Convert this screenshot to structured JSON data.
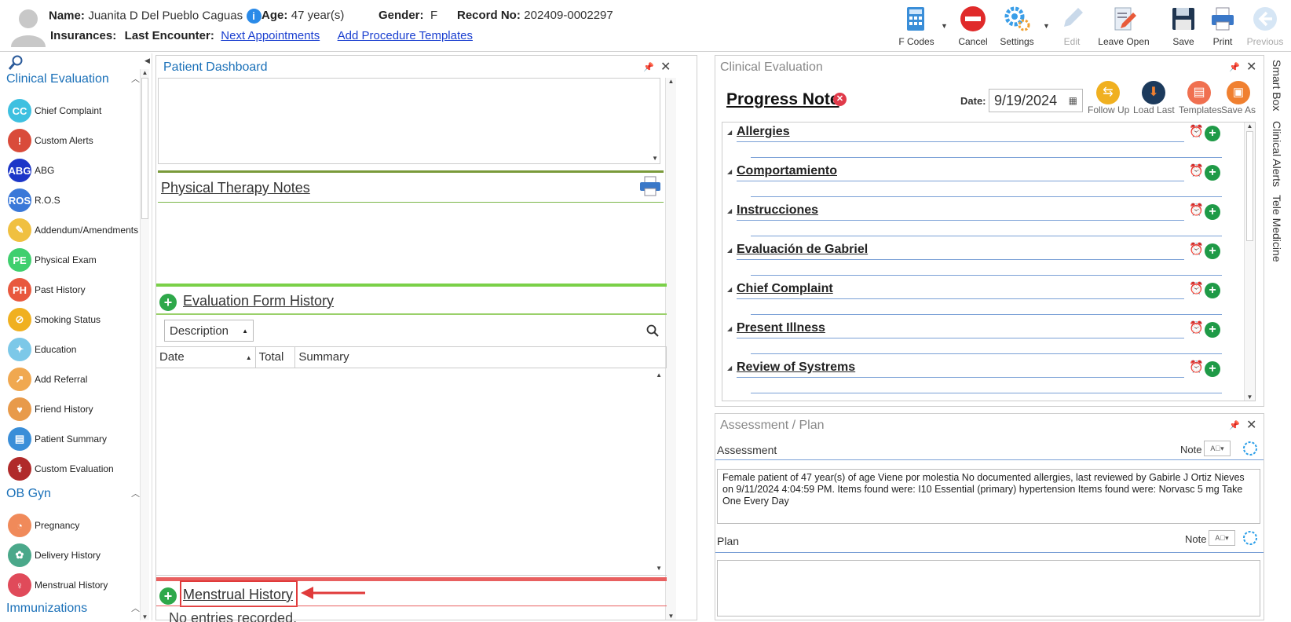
{
  "header": {
    "name_label": "Name:",
    "name_value": "Juanita D Del Pueblo Caguas",
    "age_label": "Age:",
    "age_value": "47 year(s)",
    "gender_label": "Gender:",
    "gender_value": "F",
    "record_label": "Record No:",
    "record_value": "202409-0002297",
    "insurances_label": "Insurances:",
    "last_encounter_label": "Last Encounter:",
    "next_appointments_link": "Next Appointments",
    "add_procedure_link": "Add Procedure Templates",
    "info_glyph": "i"
  },
  "toolbar": {
    "fcodes": "F Codes",
    "cancel": "Cancel",
    "settings": "Settings",
    "edit": "Edit",
    "leave_open": "Leave Open",
    "save": "Save",
    "print": "Print",
    "previous": "Previous"
  },
  "sidebar": {
    "clinical_header": "Clinical Evaluation",
    "obgyn_header": "OB Gyn",
    "immunizations_header": "Immunizations",
    "items": [
      {
        "label": "Chief Complaint",
        "glyph": "CC",
        "color": "#3ec0e0",
        "icon": "chief-complaint-icon"
      },
      {
        "label": "Custom Alerts",
        "glyph": "!",
        "color": "#d94b3a",
        "icon": "alert-bell-icon"
      },
      {
        "label": "ABG",
        "glyph": "ABG",
        "color": "#1c36c8",
        "icon": "abg-icon"
      },
      {
        "label": "R.O.S",
        "glyph": "ROS",
        "color": "#3a78d8",
        "icon": "ros-icon"
      },
      {
        "label": "Addendum/Amendments",
        "glyph": "✎",
        "color": "#f0c040",
        "icon": "addendum-icon"
      },
      {
        "label": "Physical Exam",
        "glyph": "PE",
        "color": "#3fcf6e",
        "icon": "physical-exam-icon"
      },
      {
        "label": "Past History",
        "glyph": "PH",
        "color": "#e8583e",
        "icon": "past-history-icon"
      },
      {
        "label": "Smoking Status",
        "glyph": "⊘",
        "color": "#f0b020",
        "icon": "smoking-icon"
      },
      {
        "label": "Education",
        "glyph": "✦",
        "color": "#7cc8e8",
        "icon": "education-icon"
      },
      {
        "label": "Add Referral",
        "glyph": "↗",
        "color": "#f0a850",
        "icon": "referral-icon"
      },
      {
        "label": "Friend History",
        "glyph": "♥",
        "color": "#e89a4a",
        "icon": "friend-history-icon"
      },
      {
        "label": "Patient Summary",
        "glyph": "▤",
        "color": "#3a8ed8",
        "icon": "patient-summary-icon"
      },
      {
        "label": "Custom Evaluation",
        "glyph": "⚕",
        "color": "#b02a2a",
        "icon": "stethoscope-icon"
      }
    ],
    "obgyn_items": [
      {
        "label": "Pregnancy",
        "glyph": "◔",
        "color": "#f08a5a",
        "icon": "pregnancy-icon"
      },
      {
        "label": "Delivery History",
        "glyph": "✿",
        "color": "#4aa88a",
        "icon": "delivery-icon"
      },
      {
        "label": "Menstrual History",
        "glyph": "♀",
        "color": "#e04a5a",
        "icon": "menstrual-icon"
      }
    ]
  },
  "middle": {
    "dashboard_title": "Patient Dashboard",
    "pt_notes_title": "Physical Therapy Notes",
    "eval_history_title": "Evaluation Form History",
    "description_dropdown": "Description",
    "col_date": "Date",
    "col_total": "Total",
    "col_summary": "Summary",
    "menstrual_title": "Menstrual History",
    "no_entries": "No entries recorded."
  },
  "clinical": {
    "panel_title": "Clinical Evaluation",
    "progress_note": "Progress Note",
    "date_label": "Date:",
    "date_value": "9/19/2024",
    "follow_up": "Follow Up",
    "load_last": "Load Last",
    "templates": "Templates",
    "save_as": "Save As",
    "categories": [
      "Allergies",
      "Comportamiento",
      "Instrucciones",
      "Evaluación de Gabriel",
      "Chief Complaint",
      "Present Illness",
      "Review of Systrems"
    ]
  },
  "assessment": {
    "panel_title": "Assessment / Plan",
    "assessment_label": "Assessment",
    "note_label": "Note",
    "assessment_text": "Female patient of 47 year(s) of age Viene por molestia     No documented allergies, last reviewed by Gabirle J Ortiz Nieves on 9/11/2024 4:04:59 PM.     Items found were:  I10 Essential (primary) hypertension  Items found were:  Norvasc 5 mg Take One Every Day",
    "plan_label": "Plan",
    "plan_note_label": "Note"
  },
  "right_tabs": {
    "smart_box": "Smart Box",
    "clinical_alerts": "Clinical Alerts",
    "tele_medicine": "Tele Medicine"
  },
  "colors": {
    "accent_blue": "#1a70b8",
    "link_blue": "#1a3fd0",
    "green_divider": "#7ab648",
    "red_divider": "#e86060",
    "highlight_red": "#e03a3a"
  }
}
